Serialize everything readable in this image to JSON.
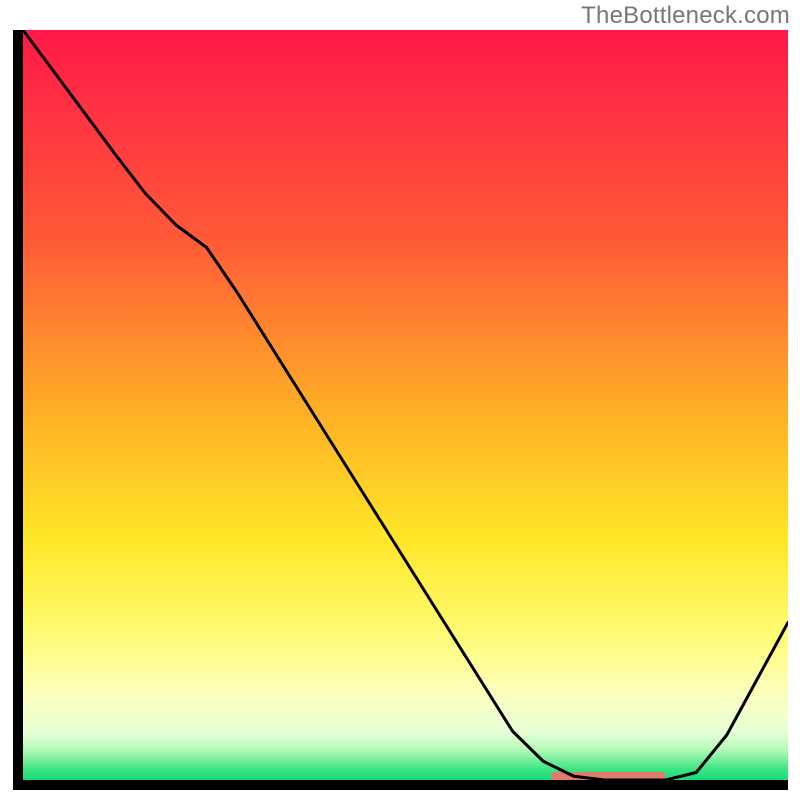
{
  "attribution": "TheBottleneck.com",
  "chart_data": {
    "type": "line",
    "title": "",
    "xlabel": "",
    "ylabel": "",
    "x": [
      0.0,
      0.04,
      0.08,
      0.12,
      0.16,
      0.2,
      0.24,
      0.28,
      0.32,
      0.36,
      0.4,
      0.44,
      0.48,
      0.52,
      0.56,
      0.6,
      0.64,
      0.68,
      0.72,
      0.76,
      0.8,
      0.84,
      0.88,
      0.92,
      0.96,
      1.0
    ],
    "values": [
      1.0,
      0.945,
      0.89,
      0.835,
      0.782,
      0.74,
      0.71,
      0.65,
      0.585,
      0.52,
      0.455,
      0.39,
      0.325,
      0.26,
      0.195,
      0.13,
      0.065,
      0.025,
      0.005,
      0.0,
      0.0,
      0.0,
      0.01,
      0.06,
      0.135,
      0.21
    ],
    "xlim": [
      0,
      1
    ],
    "ylim": [
      0,
      1
    ],
    "indicator_range_x": [
      0.69,
      0.84
    ],
    "gradient_stops": [
      {
        "offset": 0.0,
        "color": "#ff1948"
      },
      {
        "offset": 0.28,
        "color": "#ff5a37"
      },
      {
        "offset": 0.52,
        "color": "#ffb326"
      },
      {
        "offset": 0.68,
        "color": "#ffe728"
      },
      {
        "offset": 0.8,
        "color": "#fffb70"
      },
      {
        "offset": 0.88,
        "color": "#fdffb9"
      },
      {
        "offset": 0.935,
        "color": "#e9ffd7"
      },
      {
        "offset": 0.958,
        "color": "#b8fbba"
      },
      {
        "offset": 0.972,
        "color": "#7df09c"
      },
      {
        "offset": 0.985,
        "color": "#3fe585"
      },
      {
        "offset": 1.0,
        "color": "#14db79"
      }
    ],
    "indicator_color": "#e07a6a",
    "axis_color": "#000000"
  }
}
